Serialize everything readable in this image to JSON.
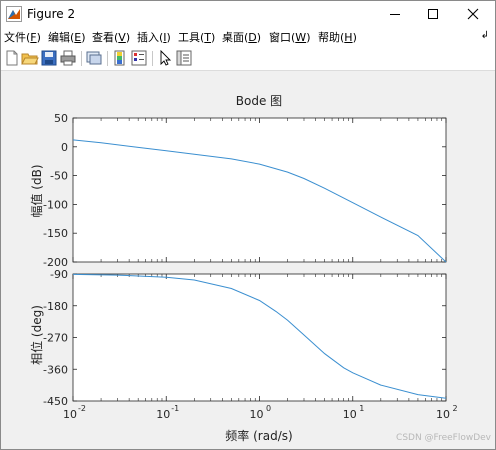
{
  "window": {
    "title": "Figure 2"
  },
  "menu": [
    {
      "label": "文件(",
      "key": "F",
      "tail": ")"
    },
    {
      "label": "编辑(",
      "key": "E",
      "tail": ")"
    },
    {
      "label": "查看(",
      "key": "V",
      "tail": ")"
    },
    {
      "label": "插入(",
      "key": "I",
      "tail": ")"
    },
    {
      "label": "工具(",
      "key": "T",
      "tail": ")"
    },
    {
      "label": "桌面(",
      "key": "D",
      "tail": ")"
    },
    {
      "label": "窗口(",
      "key": "W",
      "tail": ")"
    },
    {
      "label": "帮助(",
      "key": "H",
      "tail": ")"
    }
  ],
  "toolbar": [
    "new-figure-icon",
    "open-file-icon",
    "save-icon",
    "print-icon",
    "link-plot-icon",
    "insert-colorbar-icon",
    "insert-legend-icon",
    "edit-plot-pointer-icon",
    "property-inspector-icon"
  ],
  "chart_data": [
    {
      "type": "line",
      "title": "Bode 图",
      "ylabel": "幅值 (dB)",
      "ylim": [
        -200,
        50
      ],
      "yticks": [
        50,
        0,
        -50,
        -100,
        -150,
        -200
      ],
      "xscale": "log",
      "xlim": [
        0.01,
        100
      ],
      "grid": false,
      "series": [
        {
          "x": [
            0.01,
            0.02,
            0.05,
            0.1,
            0.2,
            0.5,
            1,
            2,
            3,
            5,
            10,
            20,
            50,
            100
          ],
          "y": [
            12,
            7,
            -1,
            -7,
            -13,
            -21,
            -30,
            -44,
            -55,
            -72,
            -97,
            -122,
            -154,
            -200
          ]
        }
      ]
    },
    {
      "type": "line",
      "ylabel": "相位 (deg)",
      "xlabel": "频率  (rad/s)",
      "ylim": [
        -450,
        -90
      ],
      "yticks": [
        -90,
        -180,
        -270,
        -360,
        -450
      ],
      "xscale": "log",
      "xlim": [
        0.01,
        100
      ],
      "xticks": [
        {
          "base": "10",
          "exp": "-2"
        },
        {
          "base": "10",
          "exp": "-1"
        },
        {
          "base": "10",
          "exp": "0"
        },
        {
          "base": "10",
          "exp": "1"
        },
        {
          "base": "10",
          "exp": "2"
        }
      ],
      "grid": false,
      "series": [
        {
          "x": [
            0.01,
            0.03,
            0.1,
            0.2,
            0.5,
            1,
            1.5,
            2,
            3,
            5,
            8,
            10,
            20,
            50,
            100
          ],
          "y": [
            -91,
            -93,
            -99,
            -107,
            -131,
            -165,
            -196,
            -221,
            -263,
            -316,
            -356,
            -370,
            -405,
            -432,
            -442
          ]
        }
      ]
    }
  ],
  "watermark": "CSDN @FreeFlowDev"
}
